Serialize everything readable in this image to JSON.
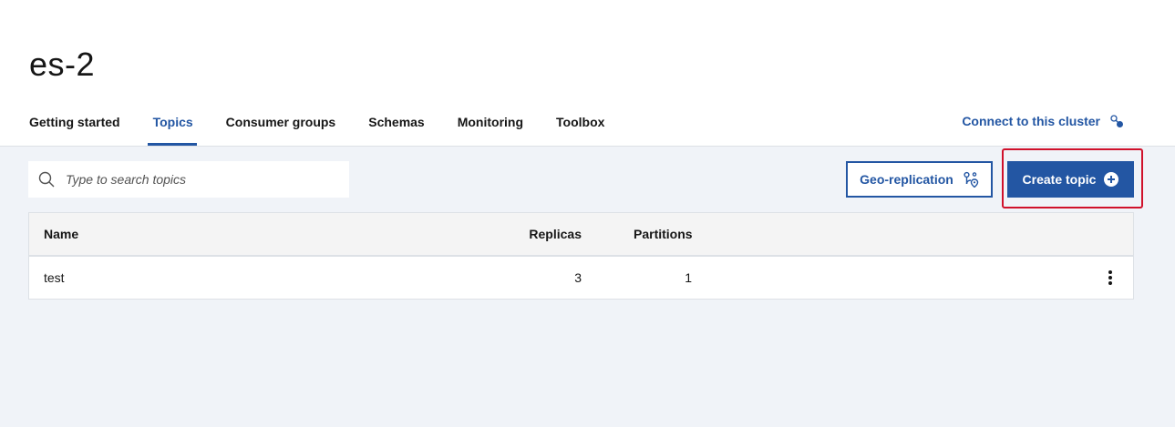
{
  "page": {
    "title": "es-2"
  },
  "tabs": [
    {
      "label": "Getting started",
      "active": false
    },
    {
      "label": "Topics",
      "active": true
    },
    {
      "label": "Consumer groups",
      "active": false
    },
    {
      "label": "Schemas",
      "active": false
    },
    {
      "label": "Monitoring",
      "active": false
    },
    {
      "label": "Toolbox",
      "active": false
    }
  ],
  "connect": {
    "label": "Connect to this cluster",
    "icon": "connection-icon"
  },
  "search": {
    "placeholder": "Type to search topics",
    "value": "",
    "icon": "search-icon"
  },
  "buttons": {
    "geo_replication": {
      "label": "Geo-replication",
      "icon": "geo-replication-icon"
    },
    "create_topic": {
      "label": "Create topic",
      "icon": "add-circle-icon"
    }
  },
  "table": {
    "columns": {
      "name": "Name",
      "replicas": "Replicas",
      "partitions": "Partitions"
    },
    "rows": [
      {
        "name": "test",
        "replicas": "3",
        "partitions": "1"
      }
    ]
  },
  "colors": {
    "accent": "#2356a3",
    "highlight": "#d0112b",
    "content_bg": "#f0f3f8"
  }
}
